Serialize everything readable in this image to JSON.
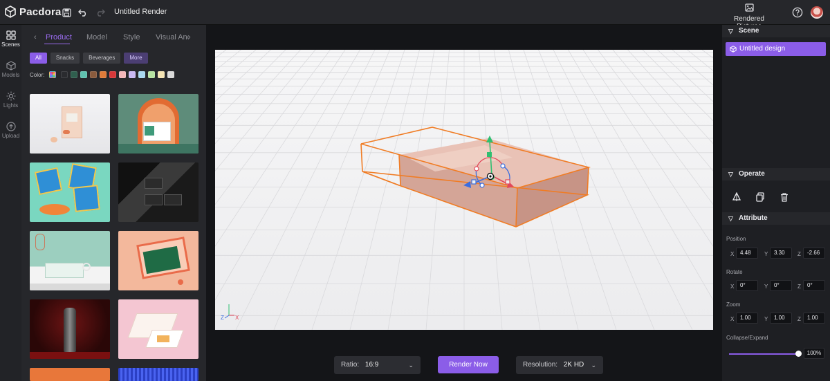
{
  "app": {
    "name": "Pacdora",
    "document_title": "Untitled Render"
  },
  "header": {
    "rendered_pictures_label": "Rendered Pictures"
  },
  "rail": [
    {
      "label": "Scenes",
      "icon": "grid-icon",
      "active": true
    },
    {
      "label": "Models",
      "icon": "cube-icon",
      "active": false
    },
    {
      "label": "Lights",
      "icon": "sun-icon",
      "active": false
    },
    {
      "label": "Upload",
      "icon": "cloud-upload-icon",
      "active": false
    }
  ],
  "library": {
    "tabs": [
      "Product",
      "Model",
      "Style",
      "Visual Anc"
    ],
    "active_tab": "Product",
    "filters": [
      "All",
      "Snacks",
      "Beverages",
      "More"
    ],
    "active_filter": "All",
    "color_label": "Color:",
    "swatches": [
      "#2a2b2f",
      "#2f5f4e",
      "#5fc2b0",
      "#8a5b3d",
      "#e07b39",
      "#d8383a",
      "#f3b6b9",
      "#c9b8f2",
      "#a8d8f0",
      "#b7e3a1",
      "#f4e3b3",
      "#d9d9d9"
    ],
    "thumbnails": [
      "Peach snack box on white",
      "Product box in green arch",
      "Blue gift boxes on orange podium",
      "Dark business cards mockup",
      "Green snack pack on shelf",
      "Salmon poster frame mockup",
      "Bottle on red radial backdrop",
      "Pink open box with tray"
    ]
  },
  "canvas": {
    "axis_labels": {
      "z": "Z",
      "x": "X"
    }
  },
  "bottom": {
    "ratio_label": "Ratio:",
    "ratio_value": "16:9",
    "render_button": "Render Now",
    "resolution_label": "Resolution:",
    "resolution_value": "2K HD"
  },
  "right": {
    "scene_title": "Scene",
    "scene_item": "Untitled design",
    "operate_title": "Operate",
    "attribute_title": "Attribute",
    "position_label": "Position",
    "position": {
      "x": "4.48",
      "y": "3.30",
      "z": "-2.66"
    },
    "rotate_label": "Rotate",
    "rotate": {
      "x": "0°",
      "y": "0°",
      "z": "0°"
    },
    "zoom_label": "Zoom",
    "zoom": {
      "x": "1.00",
      "y": "1.00",
      "z": "1.00"
    },
    "collapse_label": "Collapse/Expand",
    "collapse_value_text": "100%",
    "collapse_fraction": 1.0,
    "axis_x": "X",
    "axis_y": "Y",
    "axis_z": "Z"
  },
  "colors": {
    "accent": "#8b5de8",
    "selection": "#f07c24"
  }
}
